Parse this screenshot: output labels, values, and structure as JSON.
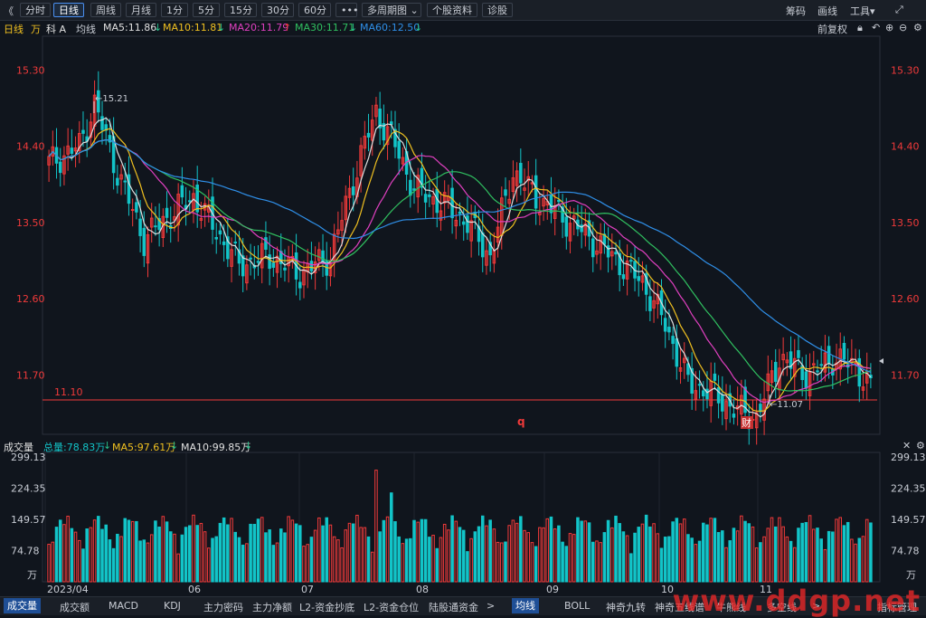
{
  "toolbar": {
    "back_glyph": "《",
    "tabs": [
      "分时",
      "日线",
      "周线",
      "月线",
      "1分",
      "5分",
      "15分",
      "30分",
      "60分",
      "•••",
      "多周期图 ⌄",
      "个股资料",
      "诊股"
    ],
    "active_index": 1,
    "right": [
      "筹码",
      "画线",
      "工具▾"
    ]
  },
  "header": {
    "period": "日线",
    "unit_glyph": "万",
    "stock_name": "科 A",
    "mode": "均线",
    "ma": [
      {
        "label": "MA5:11.86",
        "arrow": "↓",
        "color": "#e0e0e0",
        "arrow_color": "#27c089"
      },
      {
        "label": "MA10:11.81",
        "arrow": "↓",
        "color": "#f0c020",
        "arrow_color": "#27c089"
      },
      {
        "label": "MA20:11.79",
        "arrow": "↑",
        "color": "#e040c0",
        "arrow_color": "#f03a3a"
      },
      {
        "label": "MA30:11.71",
        "arrow": "↓",
        "color": "#30c060",
        "arrow_color": "#27c089"
      },
      {
        "label": "MA60:12.50",
        "arrow": "↓",
        "color": "#2f8fe8",
        "arrow_color": "#27c089"
      }
    ],
    "fq": "前复权"
  },
  "price_axis": {
    "ticks": [
      "15.30",
      "14.40",
      "13.50",
      "12.60",
      "11.70"
    ]
  },
  "annotations": {
    "high": "←15.21",
    "low": "←11.07",
    "support": "11.10",
    "q_marker": "q",
    "cai_marker": "财"
  },
  "volume": {
    "title": "成交量",
    "total": "总量:78.83万",
    "total_arrow": "↓",
    "ma5": "MA5:97.61万",
    "ma5_arrow": "↓",
    "ma10": "MA10:99.85万",
    "ma10_arrow": "↓",
    "ticks": [
      "299.13",
      "224.35",
      "149.57",
      "74.78",
      "万"
    ]
  },
  "months": [
    "2023/04",
    "06",
    "07",
    "08",
    "09",
    "10",
    "11"
  ],
  "bottom_tabs": [
    "成交量",
    "成交额",
    "MACD",
    "KDJ",
    "主力密码",
    "主力净额",
    "L2-资金抄底",
    "L2-资金仓位",
    "陆股通资金",
    ">",
    "均线",
    "BOLL",
    "神奇九转",
    "神奇五线谱",
    "牛熊线",
    "多空线",
    ">",
    "指标管理"
  ],
  "watermark": "www.ddgp.net",
  "colors": {
    "up": "#f03a3a",
    "down": "#12c4c8",
    "bg": "#10151d"
  },
  "chart_data": {
    "type": "candlestick",
    "title": "",
    "ylim_price": [
      11.0,
      15.7
    ],
    "ylim_volume": [
      0,
      310
    ],
    "ma_last": {
      "MA5": 11.86,
      "MA10": 11.81,
      "MA20": 11.79,
      "MA30": 11.71,
      "MA60": 12.5
    },
    "high_mark": 15.21,
    "low_mark": 11.07,
    "support_line": 11.1,
    "volume_total": 78.83,
    "volume_ma5": 97.61,
    "volume_ma10": 99.85
  }
}
